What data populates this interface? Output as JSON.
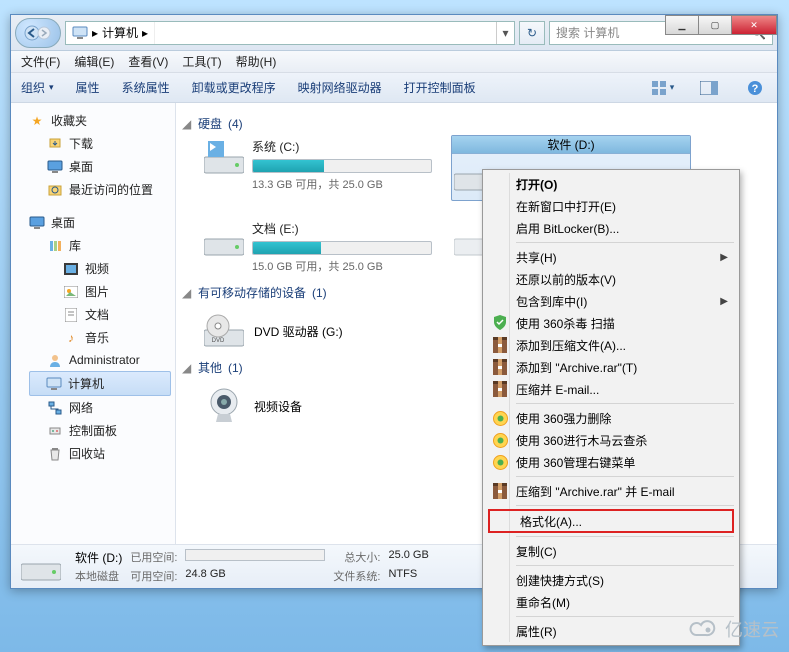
{
  "window_controls": {
    "min": "▁",
    "max": "▢",
    "close": "✕"
  },
  "address": {
    "icon": "computer-icon",
    "root": "计算机",
    "chev": "▸",
    "dropdown": "▾"
  },
  "refresh_glyph": "↻",
  "search": {
    "placeholder": "搜索 计算机",
    "icon": "🔍"
  },
  "menubar": [
    "文件(F)",
    "编辑(E)",
    "查看(V)",
    "工具(T)",
    "帮助(H)"
  ],
  "toolbar": {
    "organize": "组织",
    "organize_drop": "▾",
    "items": [
      "属性",
      "系统属性",
      "卸载或更改程序",
      "映射网络驱动器",
      "打开控制面板"
    ]
  },
  "sidebar": {
    "favorites": {
      "label": "收藏夹",
      "star": "★"
    },
    "fav_items": [
      {
        "icon": "download-icon",
        "label": "下载"
      },
      {
        "icon": "desktop-icon",
        "label": "桌面"
      },
      {
        "icon": "recent-icon",
        "label": "最近访问的位置"
      }
    ],
    "desktop": {
      "label": "桌面"
    },
    "lib": {
      "label": "库"
    },
    "lib_items": [
      "视频",
      "图片",
      "文档",
      "音乐"
    ],
    "admin": "Administrator",
    "computer": "计算机",
    "network": "网络",
    "cpanel": "控制面板",
    "recycle": "回收站"
  },
  "content": {
    "cat_hdd": {
      "label": "硬盘",
      "count": "(4)"
    },
    "drives": [
      {
        "name": "系统 (C:)",
        "fill": 40,
        "sub": "13.3 GB 可用，共 25.0 GB"
      },
      {
        "name": "软件 (D:)",
        "fill": 0,
        "sub": "",
        "selected": true
      },
      {
        "name": "文档 (E:)",
        "fill": 38,
        "sub": "15.0 GB 可用，共 25.0 GB"
      },
      {
        "name": "",
        "fill": 0,
        "placeholder": true
      }
    ],
    "cat_removable": {
      "label": "有可移动存储的设备",
      "count": "(1)"
    },
    "dvd": "DVD 驱动器 (G:)",
    "cat_other": {
      "label": "其他",
      "count": "(1)"
    },
    "video_dev": "视频设备"
  },
  "details": {
    "title": "软件 (D:)",
    "subtitle": "本地磁盘",
    "used_lbl": "已用空间:",
    "avail_lbl": "可用空间:",
    "avail_val": "24.8 GB",
    "total_lbl": "总大小:",
    "total_val": "25.0 GB",
    "fs_lbl": "文件系统:",
    "fs_val": "NTFS"
  },
  "context_menu": [
    {
      "label": "打开(O)",
      "bold": true
    },
    {
      "label": "在新窗口中打开(E)"
    },
    {
      "label": "启用 BitLocker(B)..."
    },
    {
      "sep": true
    },
    {
      "label": "共享(H)",
      "sub": true
    },
    {
      "label": "还原以前的版本(V)"
    },
    {
      "label": "包含到库中(I)",
      "sub": true
    },
    {
      "icon": "shield-green",
      "label": "使用 360杀毒 扫描"
    },
    {
      "icon": "rar",
      "label": "添加到压缩文件(A)..."
    },
    {
      "icon": "rar",
      "label": "添加到 \"Archive.rar\"(T)"
    },
    {
      "icon": "rar",
      "label": "压缩并 E-mail..."
    },
    {
      "sep": true
    },
    {
      "icon": "360y",
      "label": "使用 360强力删除"
    },
    {
      "icon": "360y",
      "label": "使用 360进行木马云查杀"
    },
    {
      "icon": "360y",
      "label": "使用 360管理右键菜单"
    },
    {
      "sep": true
    },
    {
      "icon": "rar",
      "label": "压缩到 \"Archive.rar\" 并 E-mail"
    },
    {
      "sep": true
    },
    {
      "label": "格式化(A)...",
      "highlight": true
    },
    {
      "sep": true
    },
    {
      "label": "复制(C)"
    },
    {
      "sep": true
    },
    {
      "label": "创建快捷方式(S)"
    },
    {
      "label": "重命名(M)"
    },
    {
      "sep": true
    },
    {
      "label": "属性(R)"
    }
  ],
  "watermark": "亿速云"
}
